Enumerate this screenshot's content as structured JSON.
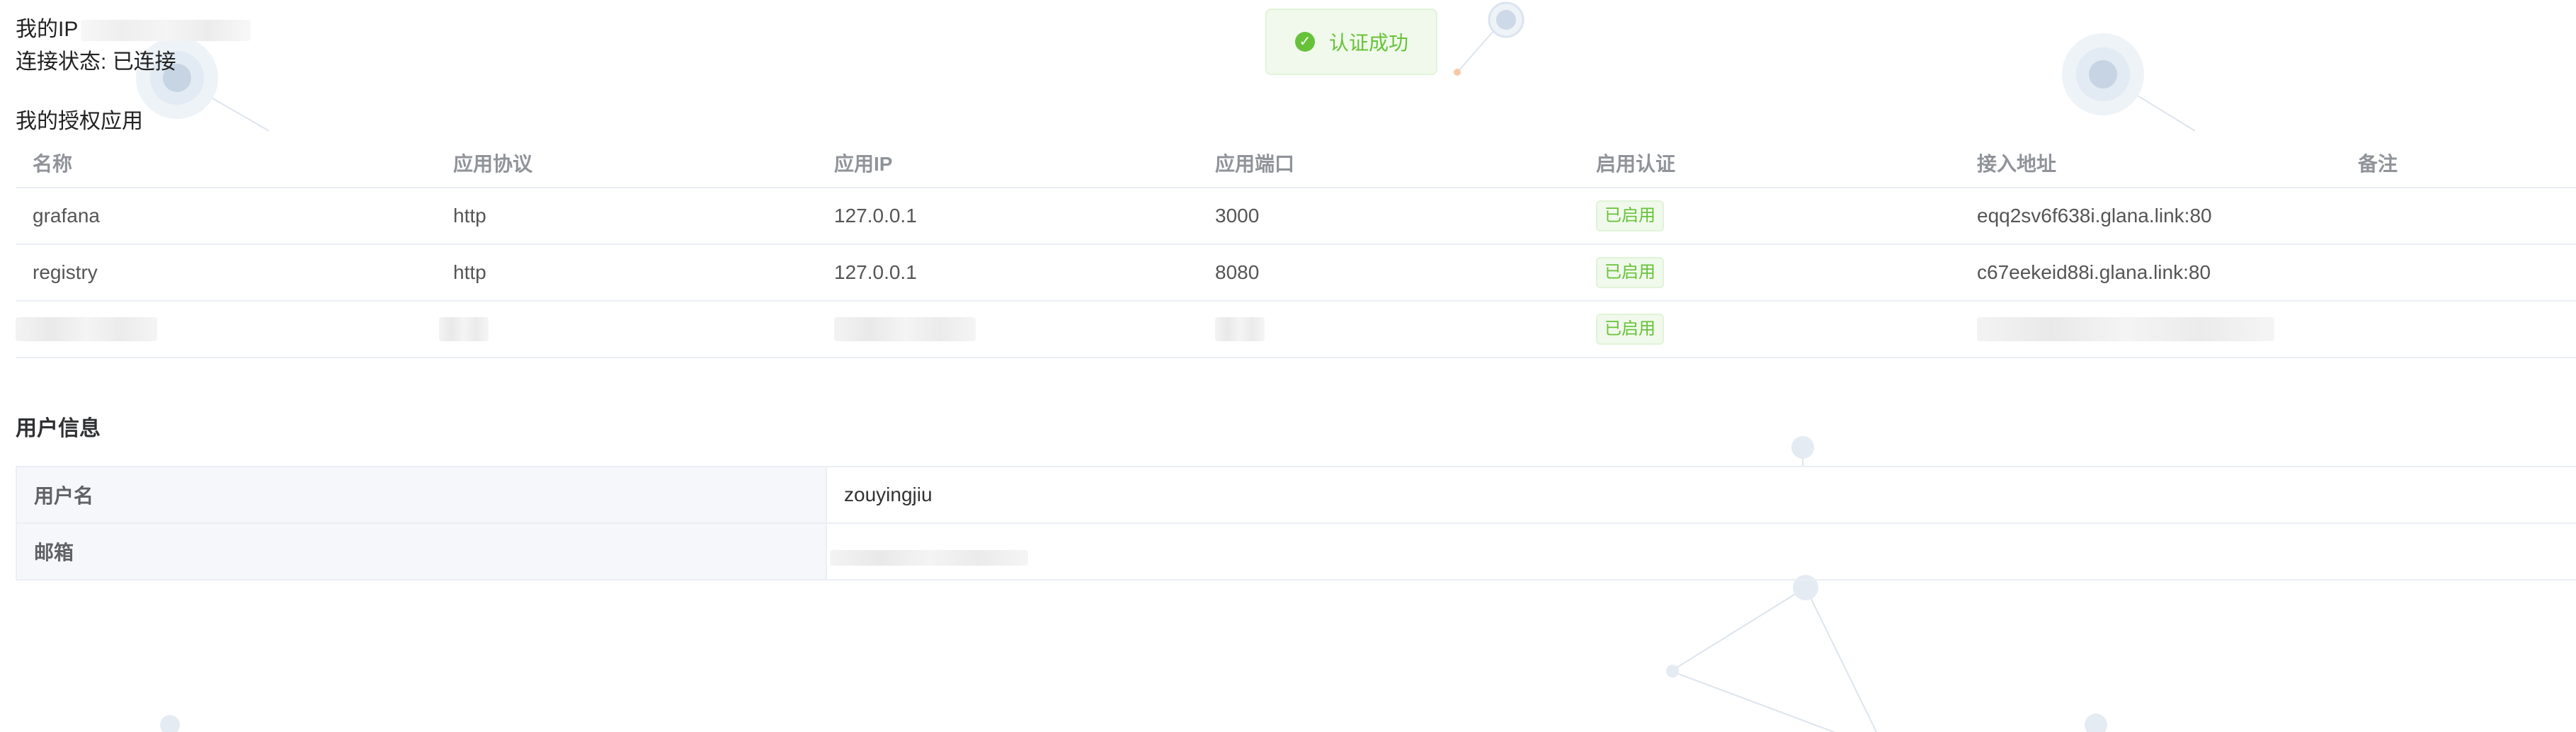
{
  "header": {
    "ip_label": "我的IP",
    "status_label": "连接状态:",
    "status_value": "已连接"
  },
  "toast": {
    "icon": "check-circle-icon",
    "text": "认证成功"
  },
  "apps": {
    "title": "我的授权应用",
    "columns": [
      "名称",
      "应用协议",
      "应用IP",
      "应用端口",
      "启用认证",
      "接入地址",
      "备注"
    ],
    "rows": [
      {
        "name": "grafana",
        "protocol": "http",
        "ip": "127.0.0.1",
        "port": "3000",
        "auth": "已启用",
        "address": "eqq2sv6f638i.glana.link:80",
        "note": ""
      },
      {
        "name": "registry",
        "protocol": "http",
        "ip": "127.0.0.1",
        "port": "8080",
        "auth": "已启用",
        "address": "c67eekeid88i.glana.link:80",
        "note": ""
      },
      {
        "name": "",
        "protocol": "",
        "ip": "",
        "port": "",
        "auth": "已启用",
        "address": "",
        "note": ""
      }
    ]
  },
  "user": {
    "title": "用户信息",
    "username_label": "用户名",
    "username_value": "zouyingjiu",
    "email_label": "邮箱",
    "email_value": ""
  },
  "colors": {
    "success": "#67c23a",
    "success_bg": "#f0f9eb",
    "border": "#ebeef5",
    "label_bg": "#f5f7fa"
  }
}
